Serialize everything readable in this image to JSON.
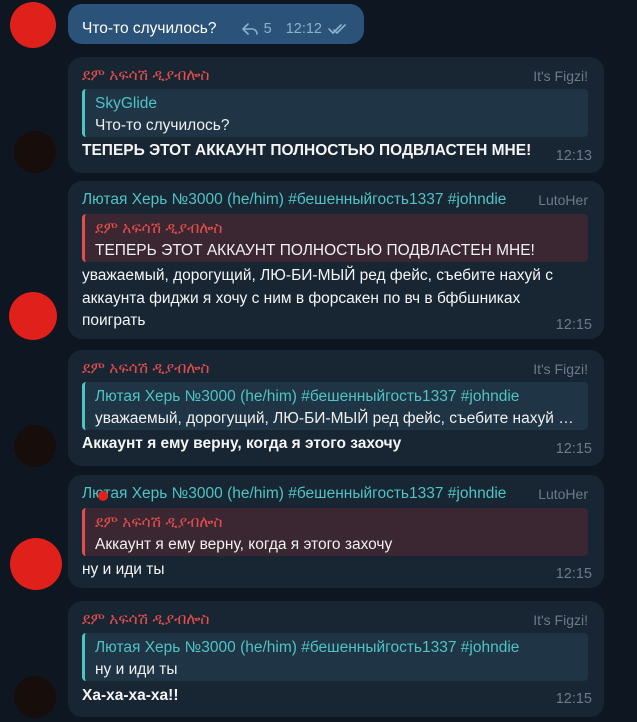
{
  "outgoing": {
    "text": "Что-то случилось?",
    "reply_count": "5",
    "time": "12:12",
    "reply_icon": "reply-arrow-icon",
    "read_icon": "double-check-icon"
  },
  "messages": [
    {
      "sender": "ደም አፍሳሽ ዲያብሎስ",
      "tag": "It's Figzi!",
      "quote": {
        "name": "SkyGlide",
        "text": "Что-то случилось?"
      },
      "text": "ТЕПЕРЬ ЭТОТ АККАУНТ ПОЛНОСТЬЮ ПОДВЛАСТЕН МНЕ!",
      "time": "12:13"
    },
    {
      "sender": "Лютая Херь №3000 (he/him) #бешенныйгость1337 #johndie",
      "tag": "LutoHer",
      "quote": {
        "name": "ደም አፍሳሽ ዲያብሎስ",
        "text": "ТЕПЕРЬ ЭТОТ АККАУНТ ПОЛНОСТЬЮ ПОДВЛАСТЕН МНЕ!"
      },
      "text_lines": [
        "уважаемый, дорогущий, ЛЮ-БИ-МЫЙ ред фейс, съебите нахуй с",
        "аккаунта фиджи я хочу с ним в форсакен по вч в бфбшниках",
        "поиграть"
      ],
      "time": "12:15"
    },
    {
      "sender": "ደም አፍሳሽ ዲያብሎስ",
      "tag": "It's Figzi!",
      "quote": {
        "name": "Лютая Херь №3000 (he/him) #бешенныйгость1337 #johndie",
        "text": "уважаемый, дорогущий, ЛЮ-БИ-МЫЙ ред фейс, съебите нахуй с аккаунта фиджи"
      },
      "text": "Аккаунт я ему верну, когда я этого захочу",
      "time": "12:15"
    },
    {
      "sender": "Лютая Херь №3000 (he/him) #бешенныйгость1337 #johndie",
      "tag": "LutoHer",
      "quote": {
        "name": "ደም አፍሳሽ ዲያብሎስ",
        "text": "Аккаунт я ему верну, когда я этого захочу"
      },
      "text": "ну и иди ты",
      "time": "12:15"
    },
    {
      "sender": "ደም አፍሳሽ ዲያብሎስ",
      "tag": "It's Figzi!",
      "quote": {
        "name": "Лютая Херь №3000 (he/him) #бешенныйгость1337 #johndie",
        "text": "ну и иди ты"
      },
      "text": "Ха-ха-ха-ха!!",
      "time": "12:15"
    }
  ]
}
